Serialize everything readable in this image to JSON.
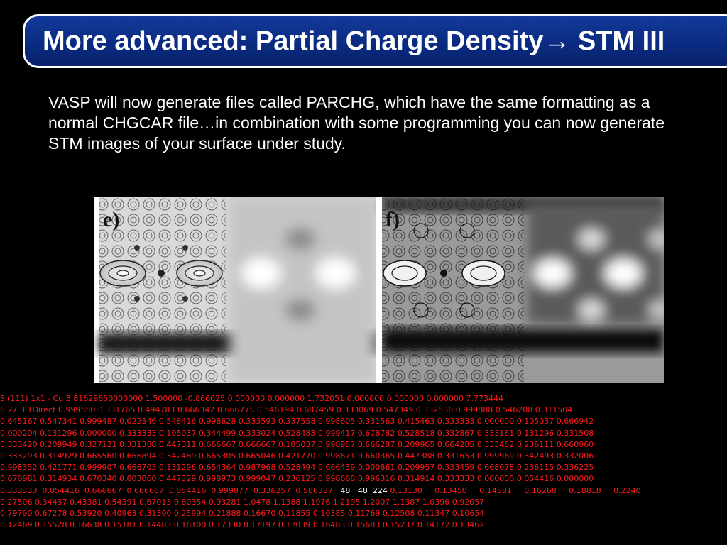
{
  "slide": {
    "title": "More advanced: Partial Charge Density→ STM III",
    "body_lines": [
      "VASP will now generate files called PARCHG, which have the same formatting as a",
      "normal CHGCAR file…in combination with some programming you can now generate",
      "STM images of your surface under study."
    ]
  },
  "figure": {
    "panel_left_label": "e)",
    "panel_right_label": "f)"
  },
  "parchg_dump": {
    "line0": "Si(111) 1x1 - Cu          3.81629650000000      1.500000  -0.866025   0.000000   0.000000   1.732051   0.000000   0.000000   0.000000   7.773444",
    "line1": "6  27  3   1Direct  0.999550  0.331765  0.494783  0.666342  0.666775  0.546194  0.687459  0.333069  0.547349  0.332536  0.999888  0.546208  0.311504",
    "line2": "0.645167  0.547341  0.999487  0.022346  0.548416  0.998628  0.333593  0.337558  0.998605  0.331563  0.415463  0.333333  0.000000  0.105037  0.666942",
    "line3": "0.000204  0.131296  0.000000  0.333333  0.105037  0.344499  0.333024  0.528483  0.999417  0.678782  0.528518  0.332867  0.333161  0.131296  0.331508",
    "line4": "0.333420  0.209949  0.327121  0.331388  0.447311  0.666667  0.666667  0.105037  0.998957  0.666287  0.209965  0.664285  0.333462  0.236111  0.660960",
    "line5": "0.333293  0.314929  0.665560  0.666894  0.342489  0.665305  0.665046  0.421770  0.998671  0.660365  0.447388  0.331653  0.999969  0.342493  0.332006",
    "line6": "0.998352  0.421771  0.999907  0.666703  0.131296  0.654364  0.987968  0.528494  0.666439  0.000861  0.209957  0.333459  0.668078  0.236115  0.336225",
    "line7": "0.670981  0.314934  0.670340  0.003060  0.447329  0.998973  0.999047  0.236125  0.998668  0.996316  0.314914  0.333333  0.000000  0.054416  0.000000",
    "line8_red": "0.333333  0.054416  0.666667  0.666667  0.054416  0.999877  0.336257  0.586387   ",
    "line8_white": "48   48  224",
    "line8_tail": " 0.13130     0.13450     0.14581     0.16268     0.18818     0.2240",
    "line9": "0.27506     0.34437     0.43381     0.54391     0.67013     0.80354     0.93281     1.0478      1.1388      1.1976      1.2195      1.2007      1.1387      1.0396     0.92057",
    "line10": "0.79790     0.67278     0.53920     0.40963     0.31390     0.25994     0.21888     0.16670     0.11855     0.10385     0.11769     0.12508     0.11347     0.10654",
    "line11": "0.12469     0.15528     0.16638     0.15181     0.14483     0.16100     0.17330     0.17197     0.17039     0.16483     0.15683     0.15237     0.14172     0.13462"
  },
  "colors": {
    "title_bar": "#0a2a80",
    "dump_text": "#ff1a1a",
    "background": "#000000"
  }
}
